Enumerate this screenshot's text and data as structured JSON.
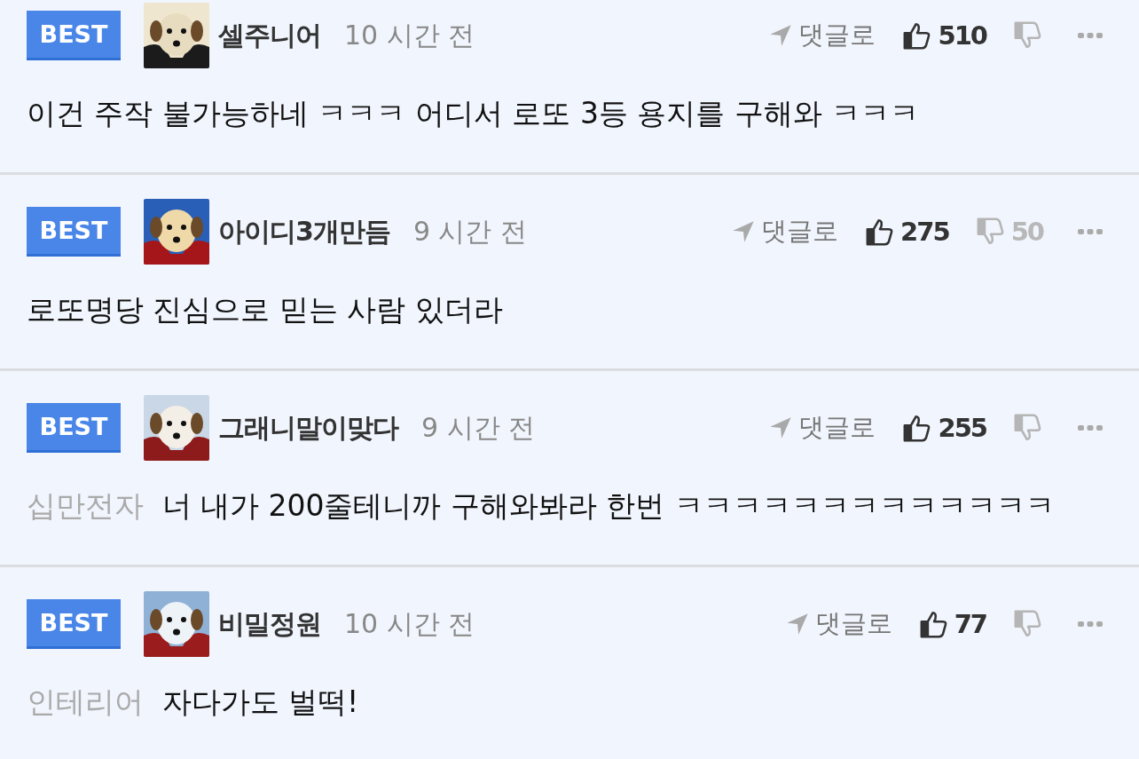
{
  "comments": [
    {
      "badge": "BEST",
      "author": "셀주니어",
      "time": "10 시간 전",
      "reply_label": "댓글로",
      "likes": "510",
      "text": "이건 주작 불가능하네 ㅋㅋㅋ 어디서 로또 3등 용지를 구해와 ㅋㅋㅋ"
    },
    {
      "badge": "BEST",
      "author": "아이디3개만듬",
      "time": "9 시간 전",
      "reply_label": "댓글로",
      "likes": "275",
      "dislikes": "50",
      "text": "로또명당 진심으로 믿는 사람 있더라"
    },
    {
      "badge": "BEST",
      "author": "그래니말이맞다",
      "time": "9 시간 전",
      "reply_label": "댓글로",
      "likes": "255",
      "mention": "십만전자",
      "text": "너 내가 200줄테니까 구해와봐라 한번 ㅋㅋㅋㅋㅋㅋㅋㅋㅋㅋㅋㅋㅋ"
    },
    {
      "badge": "BEST",
      "author": "비밀정원",
      "time": "10 시간 전",
      "reply_label": "댓글로",
      "likes": "77",
      "mention": "인테리어",
      "text": "자다가도 벌떡!"
    }
  ]
}
